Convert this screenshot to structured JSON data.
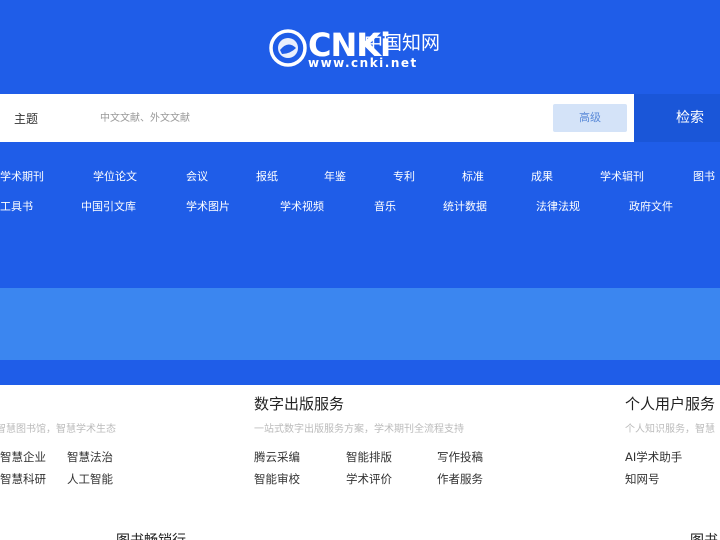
{
  "colors": {
    "hero": "#1f5de8",
    "band": "#3b86f0",
    "search_button": "#1a56d8",
    "advanced_button": "#d4e3f8"
  },
  "logo": {
    "word": "CNKi",
    "chinese": "中国知网",
    "url": "www.cnki.net",
    "emblem_icon": "globe-emblem-icon"
  },
  "search": {
    "scope": "主题",
    "placeholder": "中文文献、外文文献",
    "advanced_label": "高级",
    "submit_label": "检索"
  },
  "categories": {
    "row1": [
      "学术期刊",
      "学位论文",
      "会议",
      "报纸",
      "年鉴",
      "专利",
      "标准",
      "成果",
      "学术辑刊",
      "图书"
    ],
    "row2": [
      "工具书",
      "中国引文库",
      "学术图片",
      "学术视频",
      "音乐",
      "统计数据",
      "法律法规",
      "政府文件"
    ]
  },
  "sections": {
    "left": {
      "subtitle": "智慧图书馆，智慧学术生态",
      "services": [
        "智慧企业",
        "智慧法治",
        "智慧科研",
        "人工智能"
      ]
    },
    "middle": {
      "title": "数字出版服务",
      "subtitle": "一站式数字出版服务方案，学术期刊全流程支持",
      "services": [
        "腾云采编",
        "智能排版",
        "写作投稿",
        "智能审校",
        "学术评价",
        "作者服务"
      ]
    },
    "right": {
      "title": "个人用户服务",
      "subtitle": "个人知识服务，智慧",
      "services": [
        "AI学术助手",
        "知网号"
      ]
    }
  },
  "bottom": {
    "left_title": "图书畅销行",
    "right_title": "图书"
  }
}
